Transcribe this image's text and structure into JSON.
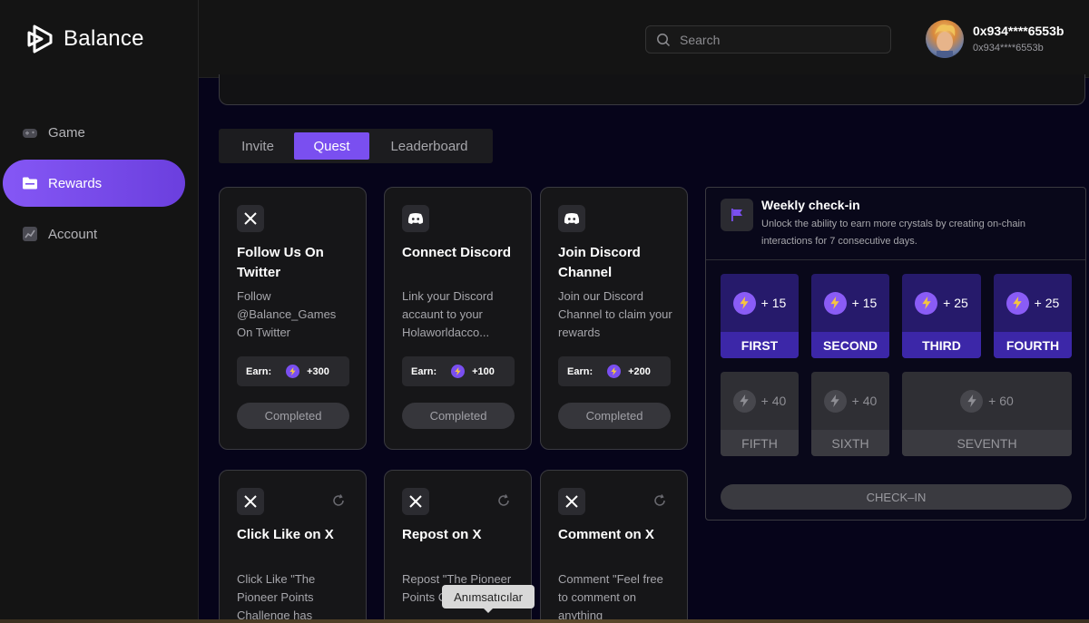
{
  "brand": {
    "name": "Balance"
  },
  "nav": [
    {
      "label": "Game",
      "icon": "gamepad-icon",
      "active": false
    },
    {
      "label": "Rewards",
      "icon": "folder-icon",
      "active": true
    },
    {
      "label": "Account",
      "icon": "chart-icon",
      "active": false
    }
  ],
  "search": {
    "placeholder": "Search"
  },
  "user": {
    "name": "0x934****6553b",
    "address": "0x934****6553b"
  },
  "tabs": [
    "Invite",
    "Quest",
    "Leaderboard"
  ],
  "quests": [
    {
      "icon": "x-icon",
      "title": "Follow Us On Twitter",
      "desc": "Follow @Balance_Games On Twitter",
      "earn_label": "Earn:",
      "reward": "+300",
      "status": "Completed"
    },
    {
      "icon": "discord-icon",
      "title": "Connect Discord",
      "desc": "Link your Discord accaunt to your Holaworldacco...",
      "earn_label": "Earn:",
      "reward": "+100",
      "status": "Completed"
    },
    {
      "icon": "discord-icon",
      "title": "Join Discord Channel",
      "desc": "Join our Discord Channel to claim your rewards",
      "earn_label": "Earn:",
      "reward": "+200",
      "status": "Completed"
    },
    {
      "icon": "x-icon",
      "title": "Click Like on X",
      "desc": "Click Like \"The Pioneer Points Challenge has"
    },
    {
      "icon": "x-icon",
      "title": "Repost on X",
      "desc": "Repost \"The Pioneer Points Challenge has"
    },
    {
      "icon": "x-icon",
      "title": "Comment on X",
      "desc": "Comment \"Feel free to comment on anything"
    }
  ],
  "checkin": {
    "title": "Weekly check-in",
    "desc": "Unlock the ability to earn more crystals by creating on-chain interactions for 7 consecutive days.",
    "days": [
      {
        "label": "FIRST",
        "reward": "+ 15",
        "claimed": true
      },
      {
        "label": "SECOND",
        "reward": "+ 15",
        "claimed": true
      },
      {
        "label": "THIRD",
        "reward": "+ 25",
        "claimed": true
      },
      {
        "label": "FOURTH",
        "reward": "+ 25",
        "claimed": true
      },
      {
        "label": "FIFTH",
        "reward": "+ 40",
        "claimed": false
      },
      {
        "label": "SIXTH",
        "reward": "+ 40",
        "claimed": false
      },
      {
        "label": "SEVENTH",
        "reward": "+ 60",
        "claimed": false
      }
    ],
    "button": "CHECK–IN"
  },
  "tooltip": "Anımsatıcılar",
  "colors": {
    "accent": "#7a4ff0",
    "background": "#06041a",
    "surface": "#161618"
  }
}
